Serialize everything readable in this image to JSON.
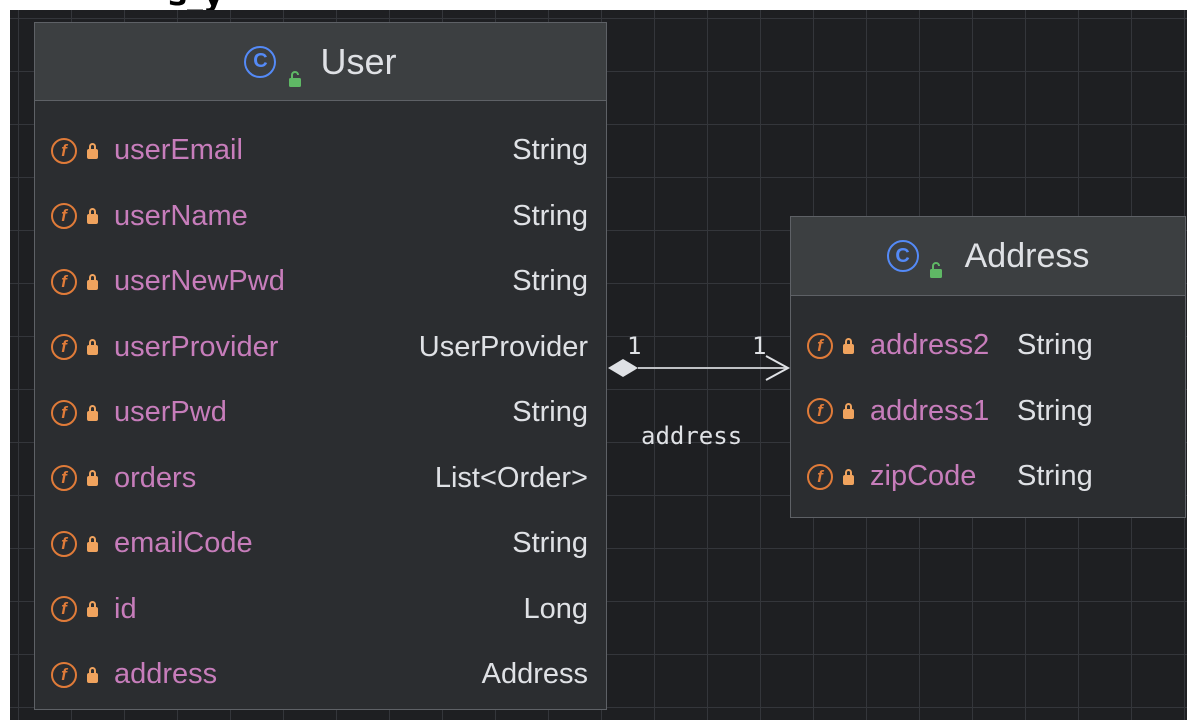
{
  "top_fragment": "s_y",
  "user_class": {
    "name": "User",
    "fields": [
      {
        "name": "userEmail",
        "type": "String"
      },
      {
        "name": "userName",
        "type": "String"
      },
      {
        "name": "userNewPwd",
        "type": "String"
      },
      {
        "name": "userProvider",
        "type": "UserProvider"
      },
      {
        "name": "userPwd",
        "type": "String"
      },
      {
        "name": "orders",
        "type": "List<Order>"
      },
      {
        "name": "emailCode",
        "type": "String"
      },
      {
        "name": "id",
        "type": "Long"
      },
      {
        "name": "address",
        "type": "Address"
      }
    ]
  },
  "address_class": {
    "name": "Address",
    "fields": [
      {
        "name": "address2",
        "type": "String"
      },
      {
        "name": "address1",
        "type": "String"
      },
      {
        "name": "zipCode",
        "type": "String"
      }
    ]
  },
  "association": {
    "label": "address",
    "source_multiplicity": "1",
    "target_multiplicity": "1",
    "kind": "composition"
  },
  "icons": {
    "class": "class-c-icon",
    "visibility_public": "open-lock-icon",
    "field": "field-f-icon",
    "visibility_private": "lock-icon"
  },
  "colors": {
    "background": "#1e1f22",
    "grid": "#34363b",
    "header": "#3c3f41",
    "body": "#2b2d30",
    "field_name": "#c77dbb",
    "type": "#dfe1e5",
    "field_icon": "#e07b39",
    "class_icon": "#548af7",
    "public_lock": "#5fb865"
  }
}
